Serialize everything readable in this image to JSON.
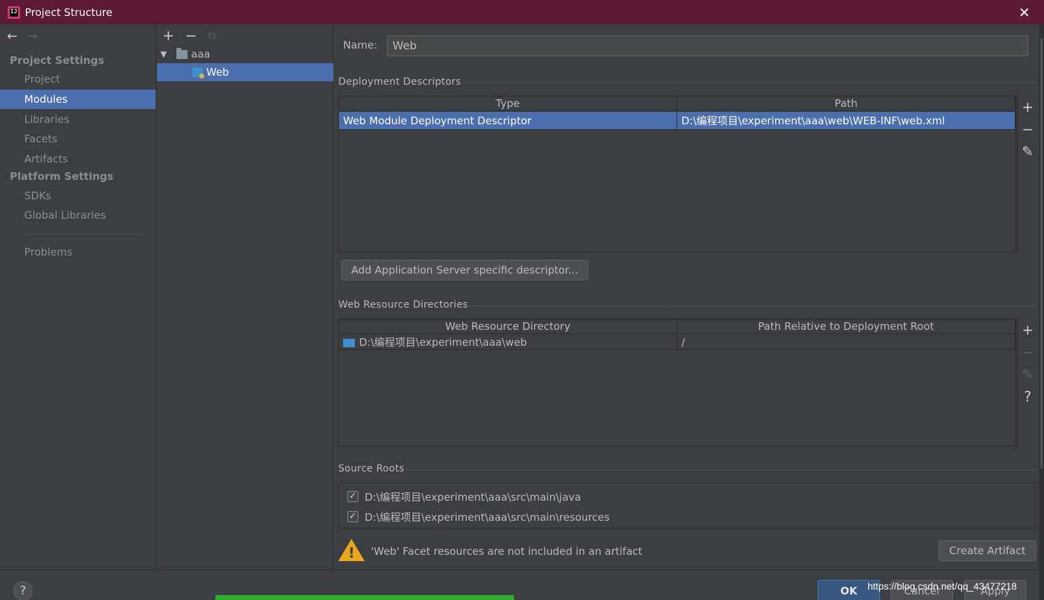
{
  "window": {
    "title": "Project Structure",
    "close_glyph": "✕"
  },
  "nav": {
    "back_glyph": "←",
    "forward_glyph": "→",
    "project_settings_header": "Project Settings",
    "platform_settings_header": "Platform Settings",
    "items": [
      {
        "label": "Project"
      },
      {
        "label": "Modules"
      },
      {
        "label": "Libraries"
      },
      {
        "label": "Facets"
      },
      {
        "label": "Artifacts"
      },
      {
        "label": "SDKs"
      },
      {
        "label": "Global Libraries"
      },
      {
        "label": "Problems"
      }
    ]
  },
  "tree": {
    "toolbar": {
      "add": "+",
      "remove": "−",
      "copy": "⧉"
    },
    "nodes": [
      {
        "label": "aaa"
      },
      {
        "label": "Web"
      }
    ]
  },
  "facet": {
    "name_label": "Name:",
    "name_value": "Web",
    "deployment": {
      "title": "Deployment Descriptors",
      "columns": [
        "Type",
        "Path"
      ],
      "rows": [
        {
          "type": "Web Module Deployment Descriptor",
          "path": "D:\\编程项目\\experiment\\aaa\\web\\WEB-INF\\web.xml"
        }
      ],
      "add_button": "Add Application Server specific descriptor..."
    },
    "web_resources": {
      "title": "Web Resource Directories",
      "columns": [
        "Web Resource Directory",
        "Path Relative to Deployment Root"
      ],
      "rows": [
        {
          "dir": "D:\\编程项目\\experiment\\aaa\\web",
          "relative": "/"
        }
      ]
    },
    "source_roots": {
      "title": "Source Roots",
      "items": [
        {
          "path": "D:\\编程项目\\experiment\\aaa\\src\\main\\java",
          "checked": true
        },
        {
          "path": "D:\\编程项目\\experiment\\aaa\\src\\main\\resources",
          "checked": true
        }
      ]
    },
    "warning": {
      "text": "'Web' Facet resources are not included in an artifact",
      "button": "Create Artifact"
    }
  },
  "tools": {
    "add": "+",
    "remove": "−",
    "edit": "✎",
    "help": "?"
  },
  "footer": {
    "help": "?",
    "ok": "OK",
    "cancel": "Cancel",
    "apply": "Apply",
    "watermark": "https://blog.csdn.net/qq_43477218"
  },
  "colors": {
    "titlebar": "#5c1a36",
    "selection": "#4b6eaf",
    "background": "#3c3f41",
    "warning": "#e8a61a"
  }
}
